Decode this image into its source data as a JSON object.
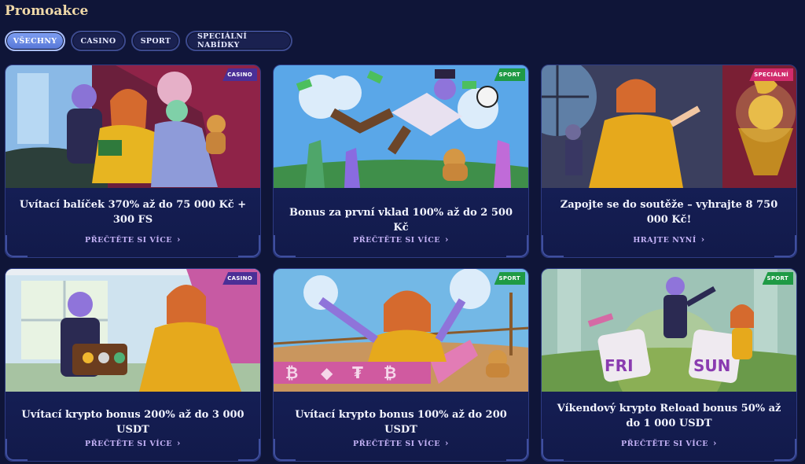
{
  "page": {
    "title": "Promoakce"
  },
  "filters": [
    {
      "label": "VŠECHNY",
      "active": true
    },
    {
      "label": "CASINO",
      "active": false
    },
    {
      "label": "SPORT",
      "active": false
    },
    {
      "label": "SPECIÁLNÍ NABÍDKY",
      "active": false
    }
  ],
  "colors": {
    "casino": "#4b2f96",
    "sport": "#1f9a45",
    "special": "#d12b6c"
  },
  "promos": [
    {
      "tag": "CASINO",
      "tag_kind": "casino",
      "title": "Uvítací balíček 370% až do 75 000 Kč + 300 FS",
      "link": "PŘEČTĚTE SI VÍCE",
      "scene": "casino-couple"
    },
    {
      "tag": "SPORT",
      "tag_kind": "sport",
      "title": "Bonus za první vklad 100% až do 2 500 Kč",
      "link": "PŘEČTĚTE SI VÍCE",
      "scene": "football-jump"
    },
    {
      "tag": "SPECIÁLNÍ",
      "tag_kind": "special",
      "title": "Zapojte se do soutěže – vyhrajte 8 750 000 Kč!",
      "link": "HRAJTE NYNÍ",
      "scene": "trophy-hall"
    },
    {
      "tag": "CASINO",
      "tag_kind": "casino",
      "title": "Uvítací krypto bonus 200% až do 3 000 USDT",
      "link": "PŘEČTĚTE SI VÍCE",
      "scene": "crypto-chest"
    },
    {
      "tag": "SPORT",
      "tag_kind": "sport",
      "title": "Uvítací krypto bonus 100% až do 200 USDT",
      "link": "PŘEČTĚTE SI VÍCE",
      "scene": "finish-line"
    },
    {
      "tag": "SPORT",
      "tag_kind": "sport",
      "title": "Víkendový krypto Reload bonus 50% až do 1 000 USDT",
      "link": "PŘEČTĚTE SI VÍCE",
      "scene": "fri-sun-dice"
    }
  ]
}
